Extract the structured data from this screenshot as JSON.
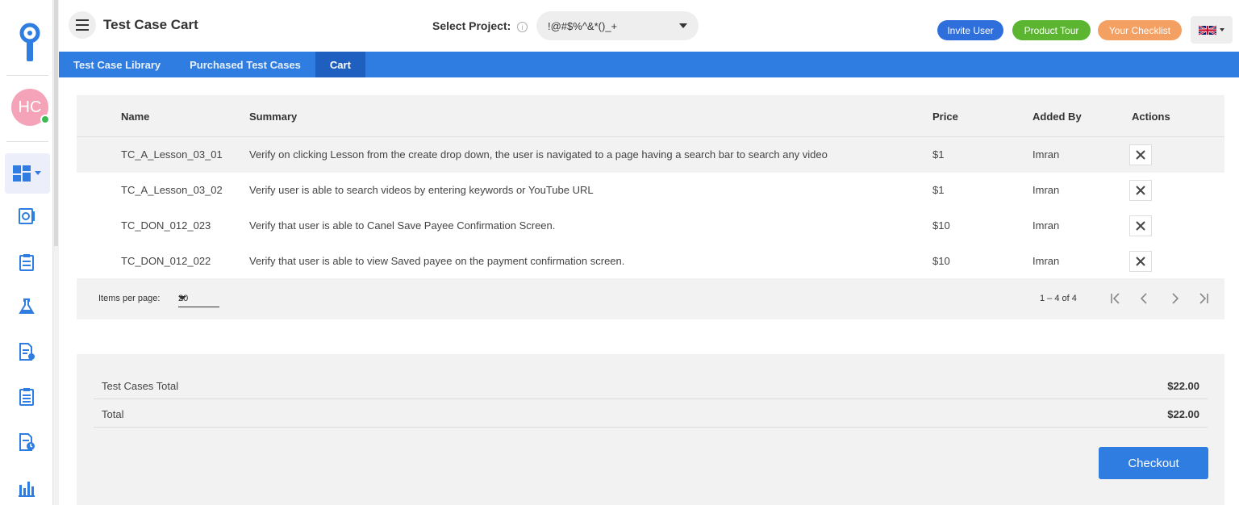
{
  "header": {
    "title": "Test Case Cart",
    "project_label": "Select Project:",
    "project_value": "!@#$%^&*()_+",
    "invite_label": "Invite User",
    "tour_label": "Product Tour",
    "checklist_label": "Your Checklist",
    "language": "en-GB"
  },
  "sidebar": {
    "avatar_initials": "HC",
    "items": [
      "dashboard-icon",
      "settings-doc-icon",
      "clipboard-list-icon",
      "flask-icon",
      "document-star-icon",
      "checklist-icon",
      "document-clock-icon",
      "bar-chart-icon"
    ]
  },
  "tabs": [
    {
      "label": "Test Case Library",
      "active": false
    },
    {
      "label": "Purchased Test Cases",
      "active": false
    },
    {
      "label": "Cart",
      "active": true
    }
  ],
  "table": {
    "headers": {
      "name": "Name",
      "summary": "Summary",
      "price": "Price",
      "added_by": "Added By",
      "actions": "Actions"
    },
    "rows": [
      {
        "name": "TC_A_Lesson_03_01",
        "summary": "Verify on clicking Lesson from the create drop down, the user is navigated to a page having a search bar to search any video",
        "price": "$1",
        "added_by": "Imran"
      },
      {
        "name": "TC_A_Lesson_03_02",
        "summary": "Verify user is able to search videos by entering keywords or YouTube URL",
        "price": "$1",
        "added_by": "Imran"
      },
      {
        "name": "TC_DON_012_023",
        "summary": "Verify that user is able to Canel Save Payee Confirmation Screen.",
        "price": "$10",
        "added_by": "Imran"
      },
      {
        "name": "TC_DON_012_022",
        "summary": "Verify that user is able to view Saved payee on the payment confirmation screen.",
        "price": "$10",
        "added_by": "Imran"
      }
    ]
  },
  "pager": {
    "items_per_page_label": "Items per page:",
    "items_per_page": "20",
    "range": "1 – 4 of 4"
  },
  "totals": {
    "test_cases_total_label": "Test Cases Total",
    "test_cases_total_value": "$22.00",
    "total_label": "Total",
    "total_value": "$22.00",
    "checkout_label": "Checkout"
  },
  "colors": {
    "primary": "#2f7de1",
    "tab_active": "#1f5fbf",
    "invite": "#2f6fdb",
    "tour": "#5cb531",
    "checklist": "#f4a063",
    "avatar": "#f5a3b8",
    "online": "#3cba54"
  }
}
